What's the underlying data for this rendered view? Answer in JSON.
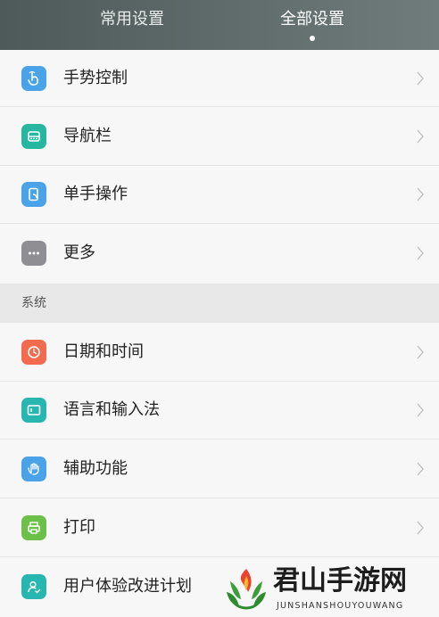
{
  "header": {
    "tabs": [
      {
        "label": "常用设置",
        "active": false
      },
      {
        "label": "全部设置",
        "active": true
      }
    ]
  },
  "rows_top": [
    {
      "label": "手势控制",
      "icon": "gesture-icon",
      "color": "#4aa3e8"
    },
    {
      "label": "导航栏",
      "icon": "navigation-bar-icon",
      "color": "#27b7a0"
    },
    {
      "label": "单手操作",
      "icon": "one-hand-icon",
      "color": "#4aa3e8"
    },
    {
      "label": "更多",
      "icon": "more-icon",
      "color": "#8e8e93"
    }
  ],
  "section": {
    "label": "系统"
  },
  "rows_system": [
    {
      "label": "日期和时间",
      "icon": "clock-icon",
      "color": "#f26b4f"
    },
    {
      "label": "语言和输入法",
      "icon": "language-icon",
      "color": "#27b7b0"
    },
    {
      "label": "辅助功能",
      "icon": "accessibility-hand-icon",
      "color": "#4aa3e8"
    },
    {
      "label": "打印",
      "icon": "printer-icon",
      "color": "#6cc04a"
    },
    {
      "label": "用户体验改进计划",
      "icon": "user-experience-icon",
      "color": "#27b7b0"
    }
  ],
  "watermark": {
    "title": "君山手游网",
    "subtitle": "JUNSHANSHOUYOUWANG"
  }
}
